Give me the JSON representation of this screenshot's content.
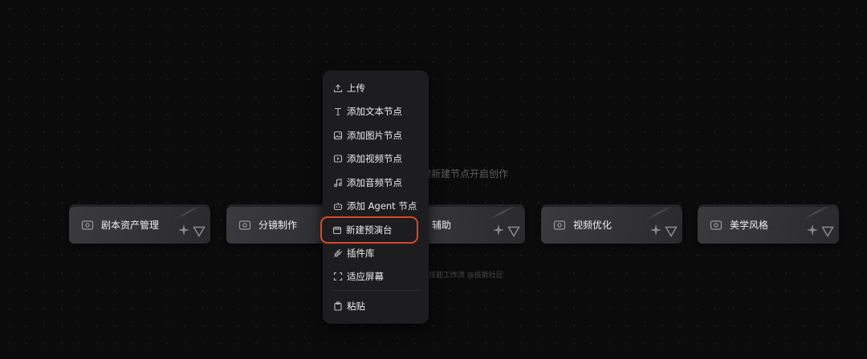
{
  "canvas": {
    "hint_text": "键新建节点开启创作",
    "watermark_text": "技能工作流 @技能社区"
  },
  "nodes": [
    {
      "label": "剧本资产管理",
      "icon": "node-icon"
    },
    {
      "label": "分镜制作",
      "icon": "node-icon"
    },
    {
      "label": "辅助",
      "icon": "node-icon"
    },
    {
      "label": "视频优化",
      "icon": "node-icon"
    },
    {
      "label": "美学风格",
      "icon": "node-icon"
    }
  ],
  "context_menu": {
    "items": [
      {
        "label": "上传",
        "icon": "upload-icon"
      },
      {
        "label": "添加文本节点",
        "icon": "text-icon"
      },
      {
        "label": "添加图片节点",
        "icon": "image-icon"
      },
      {
        "label": "添加视频节点",
        "icon": "video-icon"
      },
      {
        "label": "添加音频节点",
        "icon": "music-icon"
      },
      {
        "label": "添加 Agent 节点",
        "icon": "agent-icon"
      },
      {
        "label": "新建预演台",
        "icon": "stage-icon",
        "highlighted": true
      },
      {
        "label": "插件库",
        "icon": "plugin-icon"
      },
      {
        "label": "适应屏幕",
        "icon": "fit-screen-icon"
      },
      {
        "label": "粘贴",
        "icon": "paste-icon"
      }
    ]
  },
  "colors": {
    "background": "#0b0b0c",
    "menu_bg": "#1d1d1f",
    "highlight_border": "#d9482b"
  }
}
